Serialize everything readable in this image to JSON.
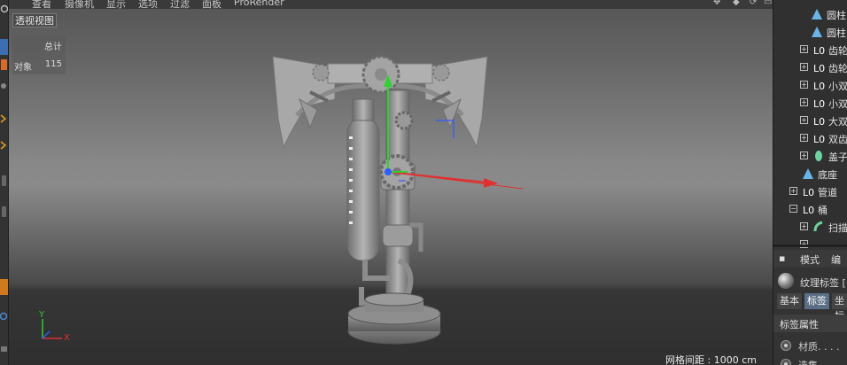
{
  "menu": {
    "items": [
      "查看",
      "摄像机",
      "显示",
      "选项",
      "过滤",
      "面板",
      "ProRender"
    ]
  },
  "viewport": {
    "view_name": "透视视图",
    "stats_header": "总计",
    "stats_label": "对象",
    "stats_value": "115",
    "grid_spacing": "网格间距 : 1000 cm",
    "axis_y": "Y",
    "axis_x": "X"
  },
  "object_manager": {
    "items": [
      {
        "label": "圆柱",
        "icon": "cone-icon"
      },
      {
        "label": "圆柱",
        "icon": "cone-icon"
      },
      {
        "label": "齿轮",
        "icon": "null-object-icon"
      },
      {
        "label": "齿轮",
        "icon": "null-object-icon"
      },
      {
        "label": "小双",
        "icon": "null-object-icon"
      },
      {
        "label": "小双",
        "icon": "null-object-icon"
      },
      {
        "label": "大双",
        "icon": "null-object-icon"
      },
      {
        "label": "双齿",
        "icon": "null-object-icon"
      },
      {
        "label": "盖子",
        "icon": "capsule-icon"
      },
      {
        "label": "底座",
        "icon": "cone-icon"
      },
      {
        "label": "管道",
        "icon": "null-object-icon"
      },
      {
        "label": "桶",
        "icon": "null-object-icon"
      },
      {
        "label": "扫描",
        "icon": "sweep-icon"
      }
    ]
  },
  "attributes": {
    "tabs": [
      "模式",
      "编辑"
    ],
    "tag_title": "纹理标签 [",
    "sub_tabs": [
      "基本",
      "标签",
      "坐标"
    ],
    "active_sub_tab": "标签",
    "section_title": "标签属性",
    "rows": [
      "材质. . . .",
      "选集"
    ]
  },
  "colors": {
    "accent": "#5a6f85",
    "axis_x": "#e03030",
    "axis_y": "#30d030",
    "axis_z": "#2f5bff"
  }
}
